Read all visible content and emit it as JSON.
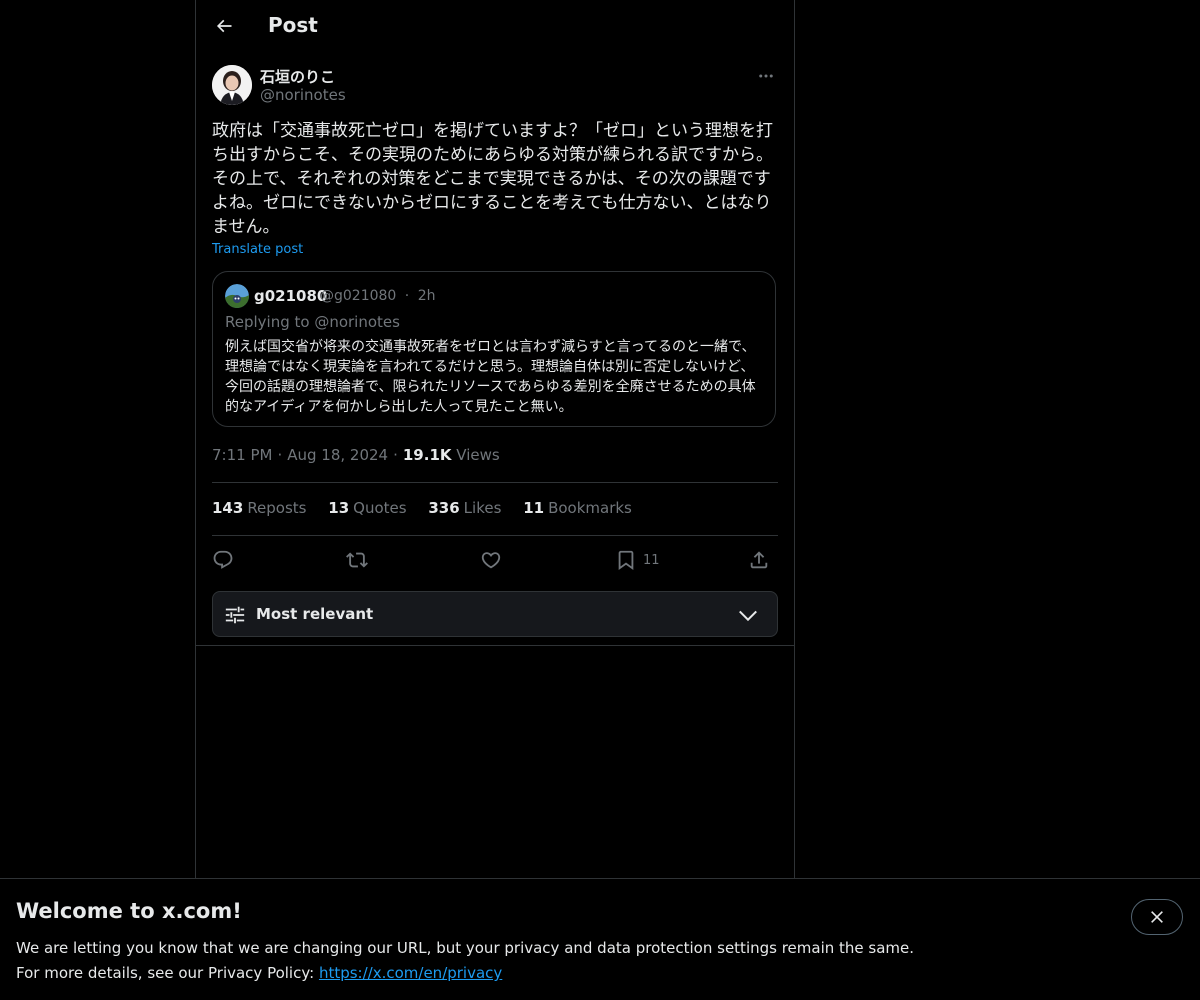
{
  "header": {
    "title": "Post",
    "back_icon": "arrow-left-icon"
  },
  "post": {
    "author_name": "石垣のりこ",
    "author_handle": "@norinotes",
    "text": "政府は「交通事故死亡ゼロ」を掲げていますよ？「ゼロ」という理想を打ち出すからこそ、その実現のためにあらゆる対策が練られる訳ですから。その上で、それぞれの対策をどこまで実現できるかは、その次の課題ですよね。ゼロにできないからゼロにすることを考えても仕方ない、とはなりません。",
    "translate_label": "Translate post",
    "time": "7:11 PM",
    "date": "Aug 18, 2024",
    "views_count": "19.1K",
    "views_label": "Views",
    "sep": "·"
  },
  "quote": {
    "name": "g021080",
    "handle": "@g021080",
    "sep": "·",
    "age": "2h",
    "replying_to": "Replying to @norinotes",
    "text": "例えば国交省が将来の交通事故死者をゼロとは言わず減らすと言ってるのと一緒で、理想論ではなく現実論を言われてるだけと思う。理想論自体は別に否定しないけど、今回の話題の理想論者で、限られたリソースであらゆる差別を全廃させるための具体的なアイディアを何かしら出した人って見たこと無い。"
  },
  "stats": {
    "reposts_count": "143",
    "reposts_label": "Reposts",
    "quotes_count": "13",
    "quotes_label": "Quotes",
    "likes_count": "336",
    "likes_label": "Likes",
    "bookmarks_count": "11",
    "bookmarks_label": "Bookmarks"
  },
  "actions": {
    "reply_icon": "reply-icon",
    "repost_icon": "repost-icon",
    "like_icon": "heart-icon",
    "bookmark_icon": "bookmark-icon",
    "bookmark_count": "11",
    "share_icon": "share-icon"
  },
  "sort": {
    "label": "Most relevant"
  },
  "banner": {
    "title": "Welcome to x.com!",
    "line1": "We are letting you know that we are changing our URL, but your privacy and data protection settings remain the same.",
    "line2_prefix": "For more details, see our Privacy Policy: ",
    "link": "https://x.com/en/privacy"
  },
  "colors": {
    "background": "#000000",
    "text": "#e7e9ea",
    "muted": "#71767b",
    "accent": "#1d9bf0",
    "border": "#2f3336"
  }
}
